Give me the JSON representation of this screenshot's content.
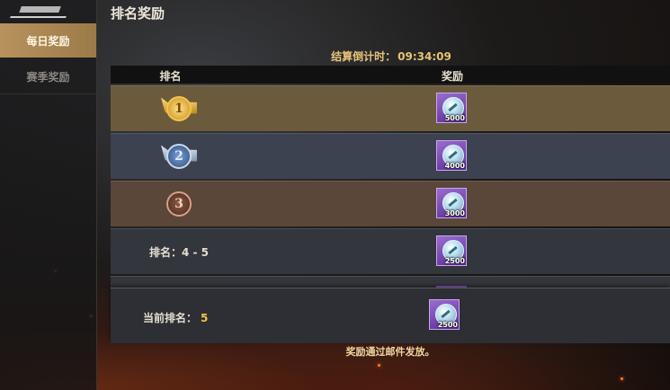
{
  "sidebar": {
    "tabs": [
      {
        "label": "每日奖励",
        "active": true
      },
      {
        "label": "赛季奖励",
        "active": false
      }
    ]
  },
  "header": {
    "title": "排名奖励"
  },
  "countdown": {
    "label": "结算倒计时：",
    "time": "09:34:09"
  },
  "table": {
    "columns": [
      "排名",
      "奖励"
    ],
    "rows": [
      {
        "rank": "1",
        "badge": "gold-rank-badge",
        "reward_qty": "5000"
      },
      {
        "rank": "2",
        "badge": "silver-rank-badge",
        "reward_qty": "4000"
      },
      {
        "rank": "3",
        "badge": "bronze-rank-badge",
        "reward_qty": "3000"
      },
      {
        "rank_label": "排名：",
        "rank_range": "4 - 5",
        "reward_qty": "2500"
      }
    ]
  },
  "current": {
    "label": "当前排名：",
    "value": "5",
    "reward_qty": "2500"
  },
  "footer": {
    "note": "奖励通过邮件发放。"
  },
  "colors": {
    "accent": "#b7925d",
    "highlight": "#f0c24a",
    "reward_frame": "#7b47b8"
  }
}
